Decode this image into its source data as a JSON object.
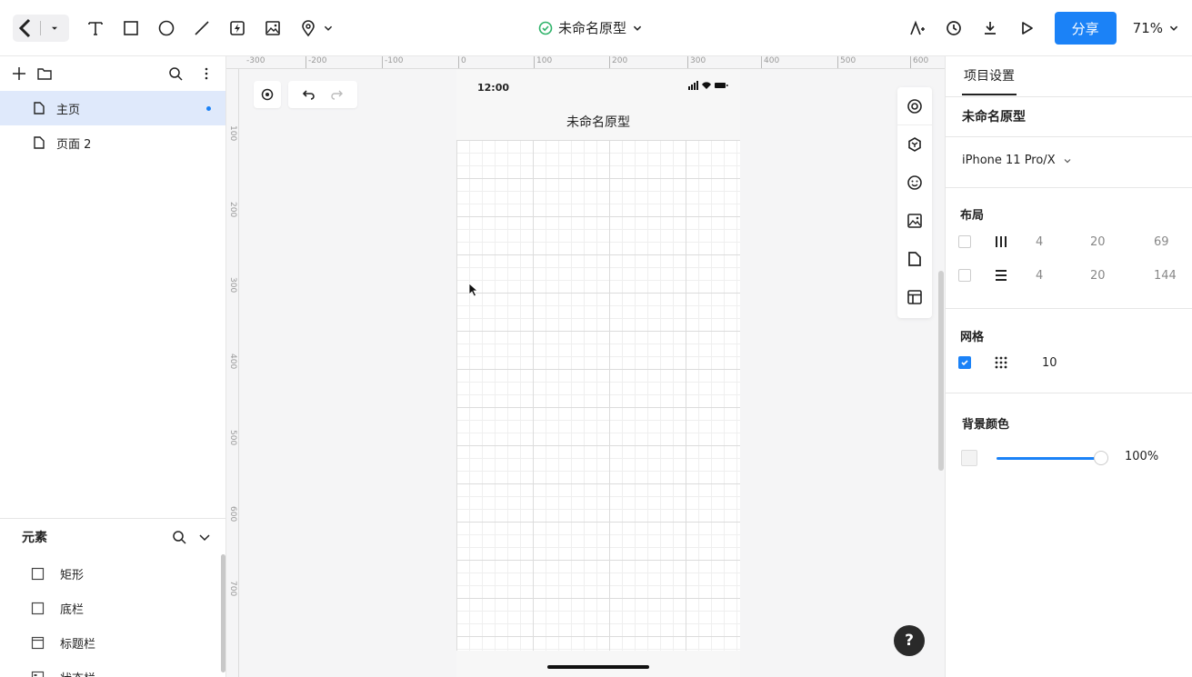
{
  "toolbar": {
    "title": "未命名原型",
    "share_label": "分享",
    "zoom": "71%"
  },
  "left_panel": {
    "pages": [
      {
        "label": "主页",
        "active": true
      },
      {
        "label": "页面 2",
        "active": false
      }
    ],
    "elements_title": "元素",
    "elements": [
      {
        "label": "矩形",
        "icon": "square-icon"
      },
      {
        "label": "底栏",
        "icon": "square-icon"
      },
      {
        "label": "标题栏",
        "icon": "titlebar-icon"
      },
      {
        "label": "状态栏",
        "icon": "statusbar-icon"
      }
    ]
  },
  "canvas": {
    "ruler_top": [
      "-300",
      "-200",
      "-100",
      "0",
      "100",
      "200",
      "300",
      "400",
      "500",
      "600"
    ],
    "ruler_left": [
      "100",
      "200",
      "300",
      "400",
      "500",
      "600",
      "700"
    ],
    "phone": {
      "time": "12:00",
      "nav_title": "未命名原型"
    },
    "help": "?"
  },
  "right_panel": {
    "tab": "项目设置",
    "project_name": "未命名原型",
    "device": "iPhone 11 Pro/X",
    "layout_title": "布局",
    "layout_rows": [
      {
        "icon": "columns-icon",
        "checked": false,
        "count": "4",
        "gutter": "20",
        "margin": "69"
      },
      {
        "icon": "rows-icon",
        "checked": false,
        "count": "4",
        "gutter": "20",
        "margin": "144"
      }
    ],
    "grid_title": "网格",
    "grid": {
      "checked": true,
      "size": "10"
    },
    "bg_title": "背景颜色",
    "bg_opacity": "100%"
  },
  "colors": {
    "accent": "#1b82f7",
    "active_page_bg": "#dfe9fb",
    "canvas_bg": "#f5f5f6"
  }
}
